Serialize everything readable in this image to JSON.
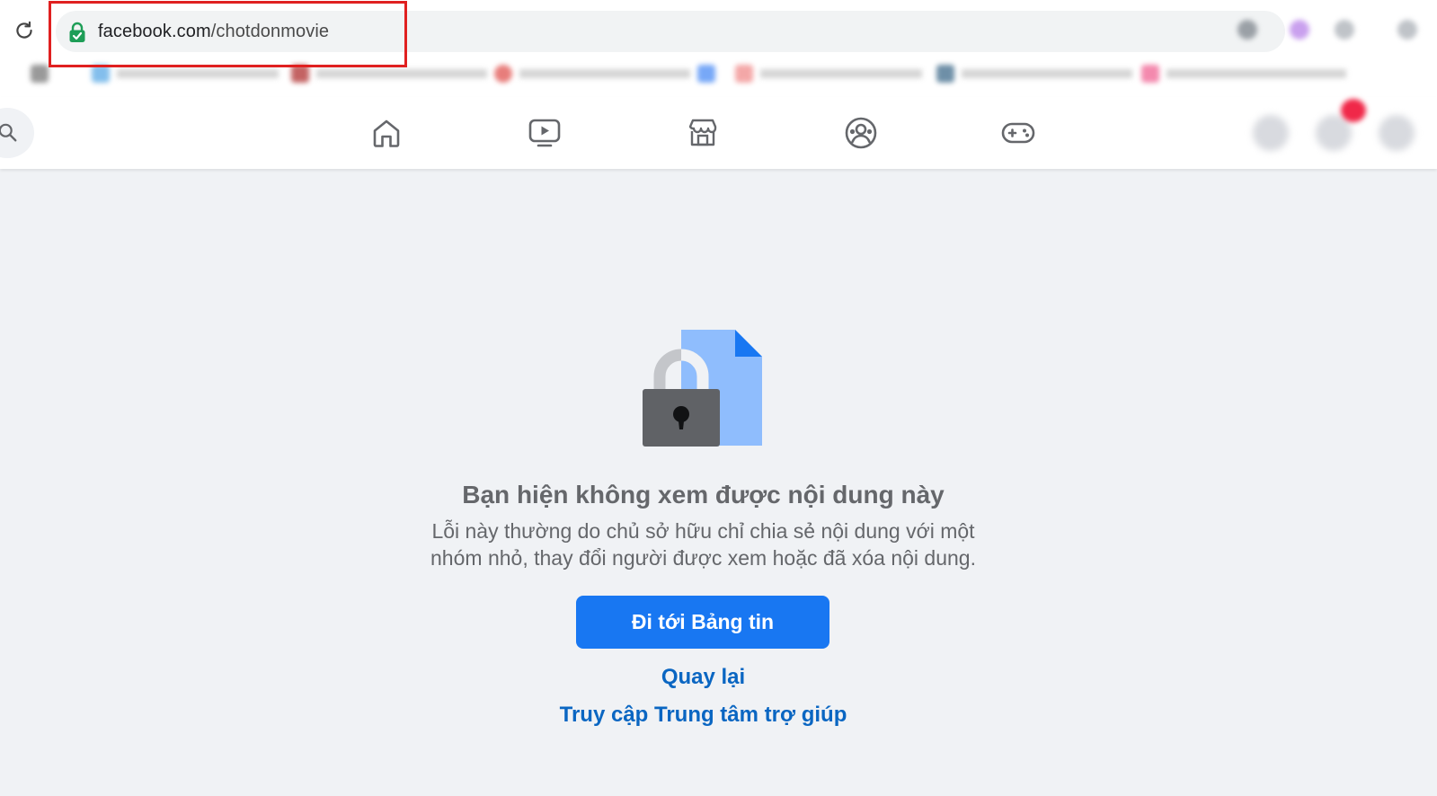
{
  "browser": {
    "url_domain": "facebook.com",
    "url_path": "/chotdonmovie"
  },
  "fb_nav": {
    "tabs": [
      "home",
      "video",
      "marketplace",
      "groups",
      "gaming"
    ]
  },
  "error_page": {
    "title": "Bạn hiện không xem được nội dung này",
    "description_line1": "Lỗi này thường do chủ sở hữu chỉ chia sẻ nội dung với một",
    "description_line2": "nhóm nhỏ, thay đổi người được xem hoặc đã xóa nội dung.",
    "primary_button": "Đi tới Bảng tin",
    "back_link": "Quay lại",
    "help_link": "Truy cập Trung tâm trợ giúp"
  },
  "colors": {
    "primary": "#1877f2",
    "link": "#0a66c2",
    "text_secondary": "#65676b",
    "page_bg": "#f0f2f5",
    "annotation_red": "#e02020"
  }
}
